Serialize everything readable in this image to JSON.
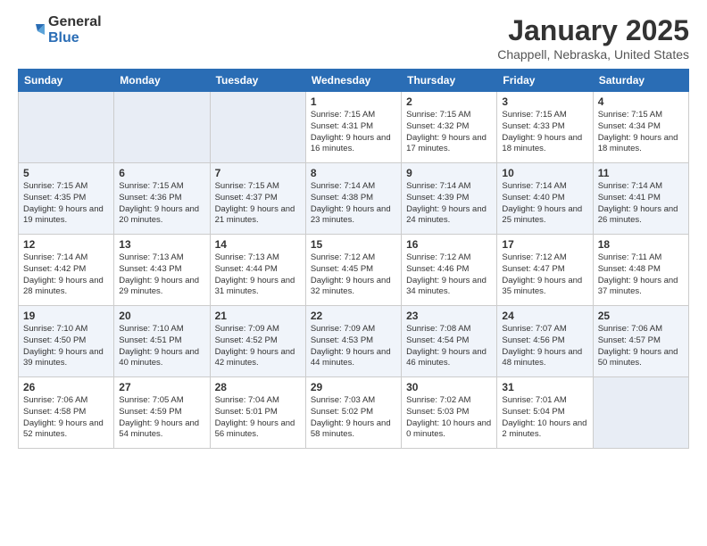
{
  "header": {
    "logo_general": "General",
    "logo_blue": "Blue",
    "month_title": "January 2025",
    "location": "Chappell, Nebraska, United States"
  },
  "days_of_week": [
    "Sunday",
    "Monday",
    "Tuesday",
    "Wednesday",
    "Thursday",
    "Friday",
    "Saturday"
  ],
  "weeks": [
    [
      {
        "day": "",
        "text": ""
      },
      {
        "day": "",
        "text": ""
      },
      {
        "day": "",
        "text": ""
      },
      {
        "day": "1",
        "text": "Sunrise: 7:15 AM\nSunset: 4:31 PM\nDaylight: 9 hours and 16 minutes."
      },
      {
        "day": "2",
        "text": "Sunrise: 7:15 AM\nSunset: 4:32 PM\nDaylight: 9 hours and 17 minutes."
      },
      {
        "day": "3",
        "text": "Sunrise: 7:15 AM\nSunset: 4:33 PM\nDaylight: 9 hours and 18 minutes."
      },
      {
        "day": "4",
        "text": "Sunrise: 7:15 AM\nSunset: 4:34 PM\nDaylight: 9 hours and 18 minutes."
      }
    ],
    [
      {
        "day": "5",
        "text": "Sunrise: 7:15 AM\nSunset: 4:35 PM\nDaylight: 9 hours and 19 minutes."
      },
      {
        "day": "6",
        "text": "Sunrise: 7:15 AM\nSunset: 4:36 PM\nDaylight: 9 hours and 20 minutes."
      },
      {
        "day": "7",
        "text": "Sunrise: 7:15 AM\nSunset: 4:37 PM\nDaylight: 9 hours and 21 minutes."
      },
      {
        "day": "8",
        "text": "Sunrise: 7:14 AM\nSunset: 4:38 PM\nDaylight: 9 hours and 23 minutes."
      },
      {
        "day": "9",
        "text": "Sunrise: 7:14 AM\nSunset: 4:39 PM\nDaylight: 9 hours and 24 minutes."
      },
      {
        "day": "10",
        "text": "Sunrise: 7:14 AM\nSunset: 4:40 PM\nDaylight: 9 hours and 25 minutes."
      },
      {
        "day": "11",
        "text": "Sunrise: 7:14 AM\nSunset: 4:41 PM\nDaylight: 9 hours and 26 minutes."
      }
    ],
    [
      {
        "day": "12",
        "text": "Sunrise: 7:14 AM\nSunset: 4:42 PM\nDaylight: 9 hours and 28 minutes."
      },
      {
        "day": "13",
        "text": "Sunrise: 7:13 AM\nSunset: 4:43 PM\nDaylight: 9 hours and 29 minutes."
      },
      {
        "day": "14",
        "text": "Sunrise: 7:13 AM\nSunset: 4:44 PM\nDaylight: 9 hours and 31 minutes."
      },
      {
        "day": "15",
        "text": "Sunrise: 7:12 AM\nSunset: 4:45 PM\nDaylight: 9 hours and 32 minutes."
      },
      {
        "day": "16",
        "text": "Sunrise: 7:12 AM\nSunset: 4:46 PM\nDaylight: 9 hours and 34 minutes."
      },
      {
        "day": "17",
        "text": "Sunrise: 7:12 AM\nSunset: 4:47 PM\nDaylight: 9 hours and 35 minutes."
      },
      {
        "day": "18",
        "text": "Sunrise: 7:11 AM\nSunset: 4:48 PM\nDaylight: 9 hours and 37 minutes."
      }
    ],
    [
      {
        "day": "19",
        "text": "Sunrise: 7:10 AM\nSunset: 4:50 PM\nDaylight: 9 hours and 39 minutes."
      },
      {
        "day": "20",
        "text": "Sunrise: 7:10 AM\nSunset: 4:51 PM\nDaylight: 9 hours and 40 minutes."
      },
      {
        "day": "21",
        "text": "Sunrise: 7:09 AM\nSunset: 4:52 PM\nDaylight: 9 hours and 42 minutes."
      },
      {
        "day": "22",
        "text": "Sunrise: 7:09 AM\nSunset: 4:53 PM\nDaylight: 9 hours and 44 minutes."
      },
      {
        "day": "23",
        "text": "Sunrise: 7:08 AM\nSunset: 4:54 PM\nDaylight: 9 hours and 46 minutes."
      },
      {
        "day": "24",
        "text": "Sunrise: 7:07 AM\nSunset: 4:56 PM\nDaylight: 9 hours and 48 minutes."
      },
      {
        "day": "25",
        "text": "Sunrise: 7:06 AM\nSunset: 4:57 PM\nDaylight: 9 hours and 50 minutes."
      }
    ],
    [
      {
        "day": "26",
        "text": "Sunrise: 7:06 AM\nSunset: 4:58 PM\nDaylight: 9 hours and 52 minutes."
      },
      {
        "day": "27",
        "text": "Sunrise: 7:05 AM\nSunset: 4:59 PM\nDaylight: 9 hours and 54 minutes."
      },
      {
        "day": "28",
        "text": "Sunrise: 7:04 AM\nSunset: 5:01 PM\nDaylight: 9 hours and 56 minutes."
      },
      {
        "day": "29",
        "text": "Sunrise: 7:03 AM\nSunset: 5:02 PM\nDaylight: 9 hours and 58 minutes."
      },
      {
        "day": "30",
        "text": "Sunrise: 7:02 AM\nSunset: 5:03 PM\nDaylight: 10 hours and 0 minutes."
      },
      {
        "day": "31",
        "text": "Sunrise: 7:01 AM\nSunset: 5:04 PM\nDaylight: 10 hours and 2 minutes."
      },
      {
        "day": "",
        "text": ""
      }
    ]
  ]
}
